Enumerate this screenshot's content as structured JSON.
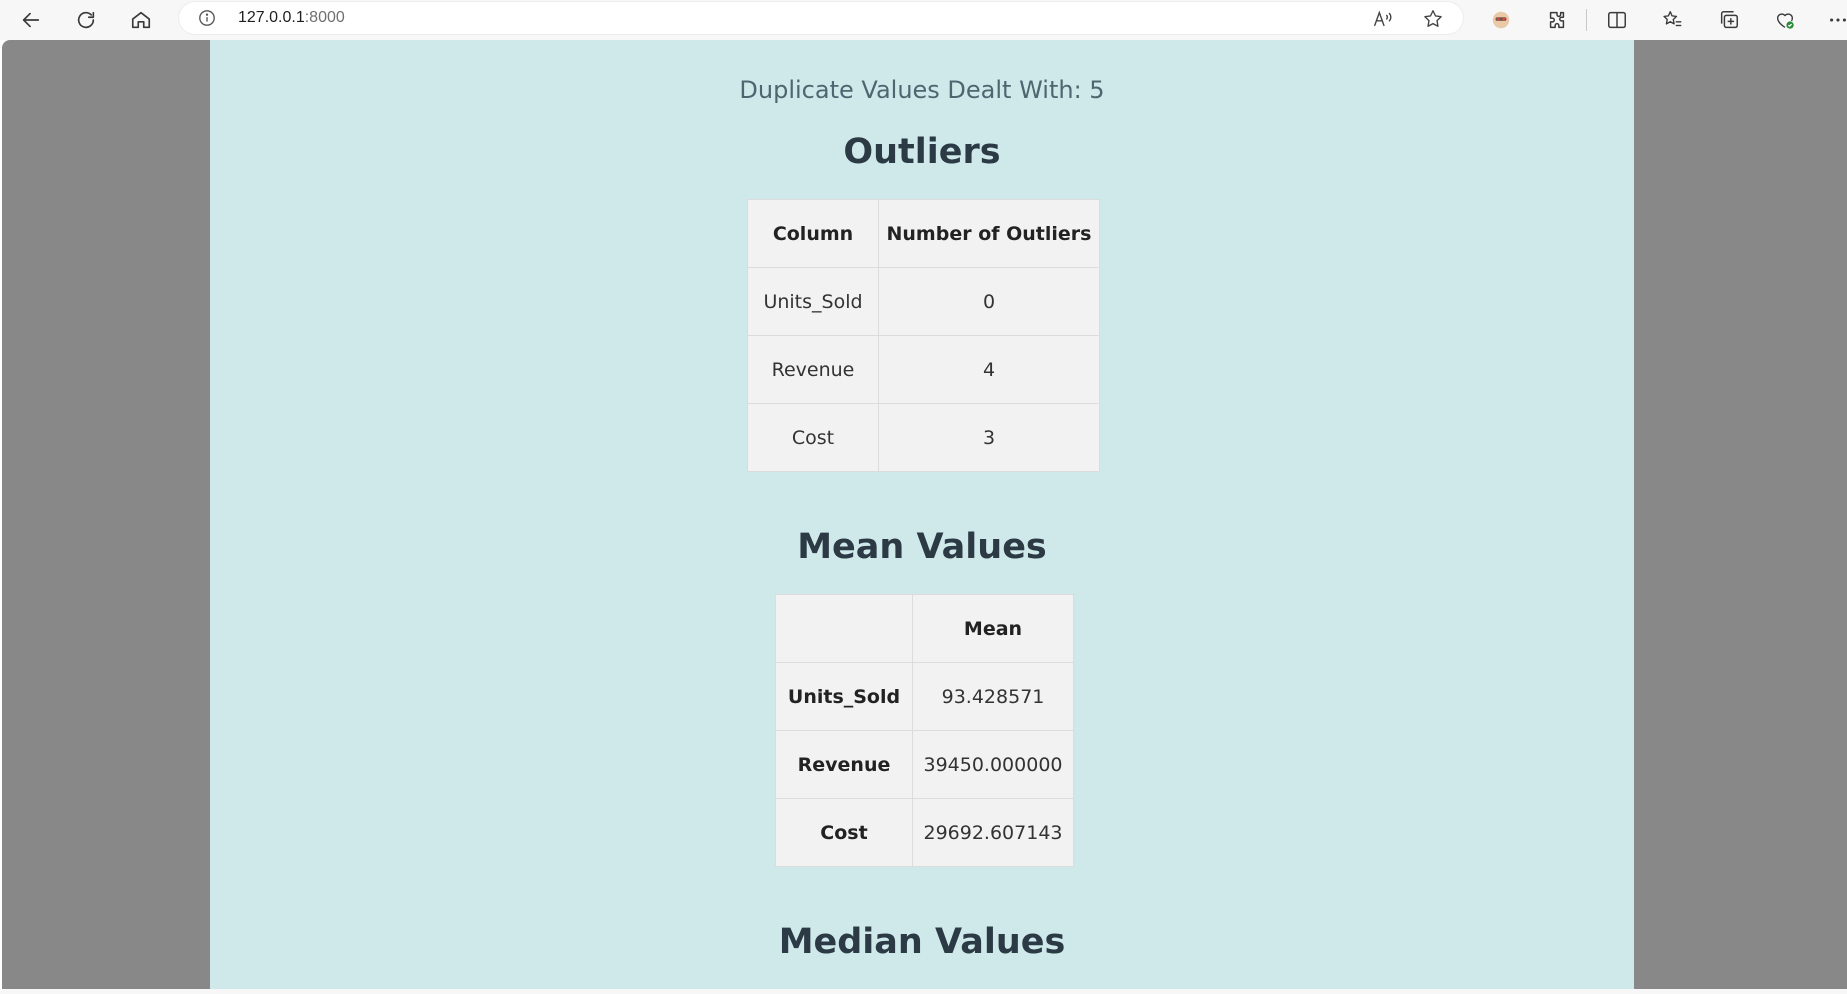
{
  "browser": {
    "url_host": "127.0.0.1",
    "url_port": ":8000"
  },
  "page": {
    "duplicate_text": "Duplicate Values Dealt With: 5",
    "outliers": {
      "title": "Outliers",
      "headers": [
        "Column",
        "Number of Outliers"
      ],
      "rows": [
        [
          "Units_Sold",
          "0"
        ],
        [
          "Revenue",
          "4"
        ],
        [
          "Cost",
          "3"
        ]
      ]
    },
    "mean": {
      "title": "Mean Values",
      "headers": [
        "",
        "Mean"
      ],
      "rows": [
        [
          "Units_Sold",
          "93.428571"
        ],
        [
          "Revenue",
          "39450.000000"
        ],
        [
          "Cost",
          "29692.607143"
        ]
      ]
    },
    "median": {
      "title": "Median Values"
    }
  }
}
